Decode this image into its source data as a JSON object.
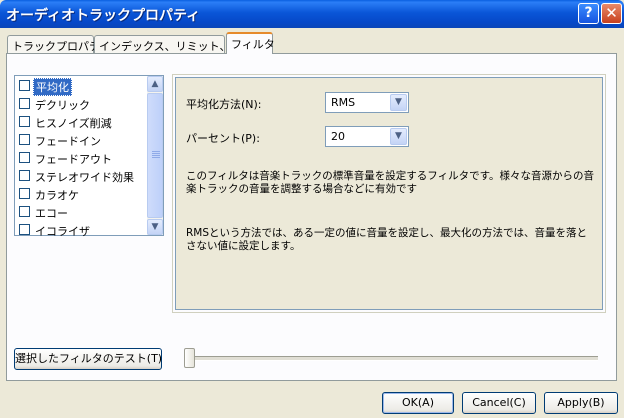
{
  "window": {
    "title": "オーディオトラックプロパティ",
    "help_icon": "?",
    "close_icon": "✕"
  },
  "tabs": [
    {
      "label": "トラックプロパティ"
    },
    {
      "label": "インデックス、リミット、分割"
    },
    {
      "label": "フィルタ"
    }
  ],
  "filters": {
    "selected": "平均化",
    "items": [
      {
        "label": "平均化",
        "checked": false
      },
      {
        "label": "デクリック",
        "checked": false
      },
      {
        "label": "ヒスノイズ削減",
        "checked": false
      },
      {
        "label": "フェードイン",
        "checked": false
      },
      {
        "label": "フェードアウト",
        "checked": false
      },
      {
        "label": "ステレオワイド効果",
        "checked": false
      },
      {
        "label": "カラオケ",
        "checked": false
      },
      {
        "label": "エコー",
        "checked": false
      },
      {
        "label": "イコライザ",
        "checked": false
      }
    ]
  },
  "settings": {
    "method_label": "平均化方法(N):",
    "method_value": "RMS",
    "percent_label": "パーセント(P):",
    "percent_value": "20",
    "description1": "このフィルタは音楽トラックの標準音量を設定するフィルタです。様々な音源からの音楽トラックの音量を調整する場合などに有効です",
    "description2": "RMSという方法では、ある一定の値に音量を設定し、最大化の方法では、音量を落とさない値に設定します。"
  },
  "test_button": "選択したフィルタのテスト(T)",
  "buttons": {
    "ok": "OK(A)",
    "cancel": "Cancel(C)",
    "apply": "Apply(B)"
  }
}
